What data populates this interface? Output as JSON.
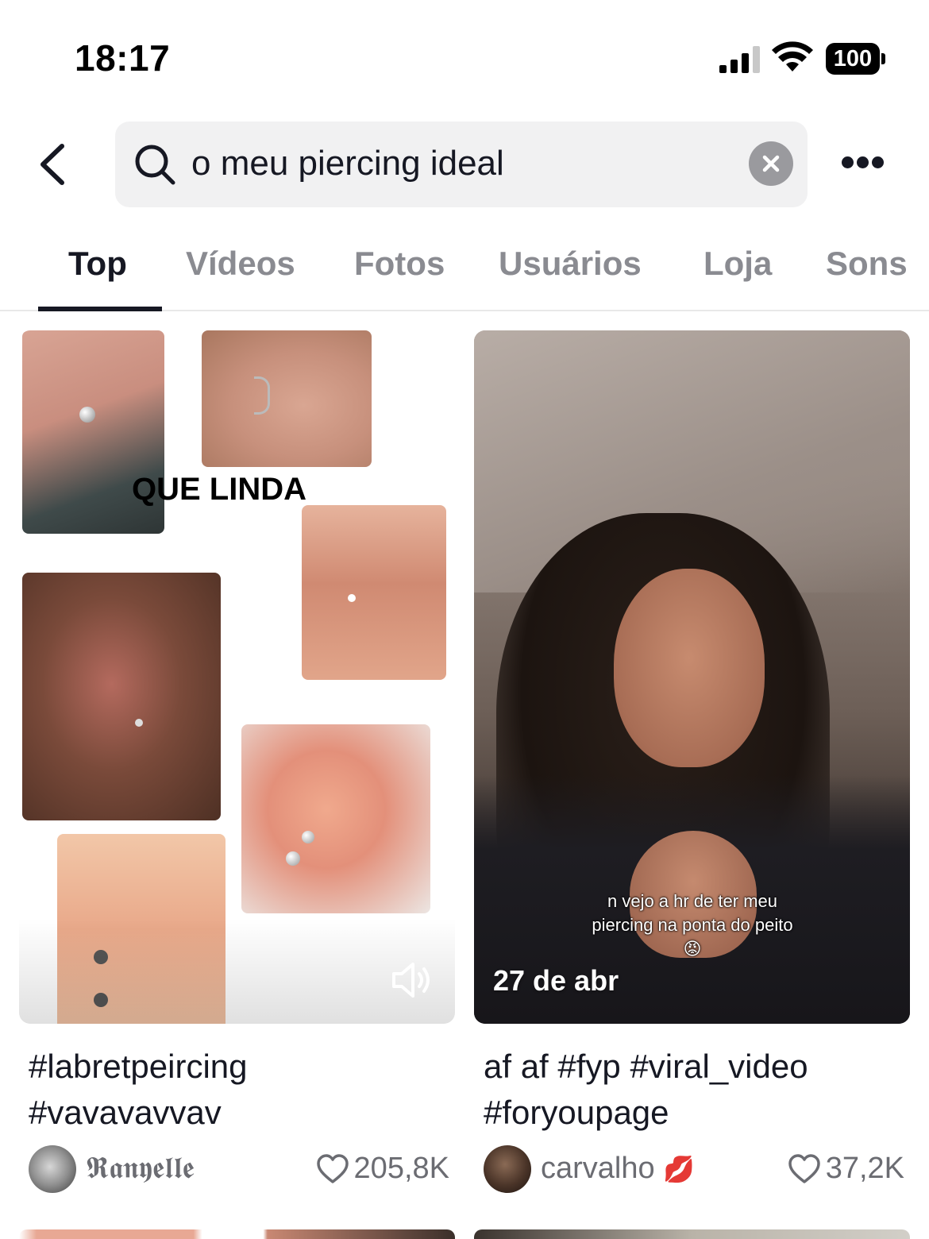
{
  "status_bar": {
    "time": "18:17",
    "battery": "100"
  },
  "search": {
    "query": "o meu piercing ideal"
  },
  "tabs": [
    {
      "label": "Top",
      "active": true
    },
    {
      "label": "Vídeos",
      "active": false
    },
    {
      "label": "Fotos",
      "active": false
    },
    {
      "label": "Usuários",
      "active": false
    },
    {
      "label": "Loja",
      "active": false
    },
    {
      "label": "Sons",
      "active": false
    }
  ],
  "results": [
    {
      "overlay_title": "QUE LINDA",
      "caption_line1": "#labretpeircing",
      "caption_line2": "#vavavavvav",
      "username": "𝕽𝖆𝖓𝖞𝖊𝖑𝖑𝖊",
      "likes": "205,8K",
      "has_sound_icon": true
    },
    {
      "date": "27 de abr",
      "overlay_line1": "n vejo a hr de ter meu",
      "overlay_line2": "piercing na ponta do peito",
      "overlay_emoji": "😡",
      "caption_line1": "af af #fyp #viral_video",
      "caption_line2": "#foryoupage",
      "username": "carvalho",
      "username_emoji": "💋",
      "likes": "37,2K"
    }
  ],
  "colors": {
    "text_primary": "#161823",
    "text_secondary": "#8a8b91",
    "search_bg": "#f1f1f2"
  }
}
